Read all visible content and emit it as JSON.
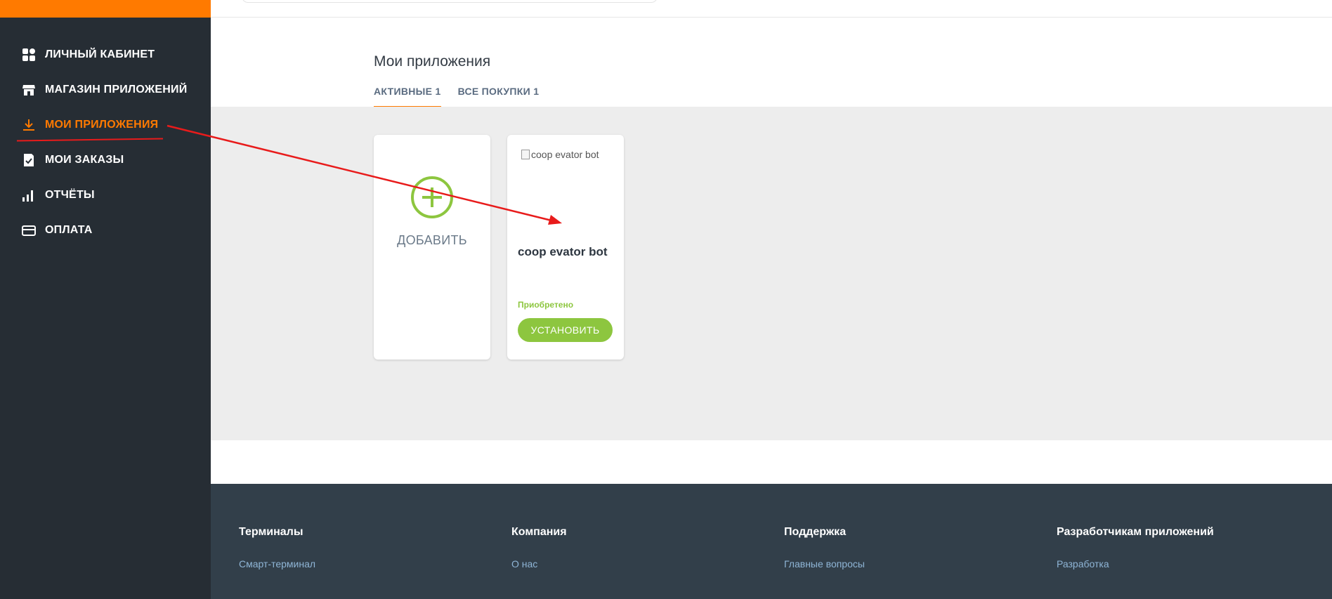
{
  "sidebar": {
    "items": [
      {
        "label": "ЛИЧНЫЙ КАБИНЕТ",
        "icon": "dashboard-icon"
      },
      {
        "label": "МАГАЗИН ПРИЛОЖЕНИЙ",
        "icon": "store-icon"
      },
      {
        "label": "МОИ ПРИЛОЖЕНИЯ",
        "icon": "download-icon",
        "active": true
      },
      {
        "label": "МОИ ЗАКАЗЫ",
        "icon": "orders-icon"
      },
      {
        "label": "ОТЧЁТЫ",
        "icon": "bar-chart-icon"
      },
      {
        "label": "ОПЛАТА",
        "icon": "credit-card-icon"
      }
    ]
  },
  "colors": {
    "accent": "#ff7a00",
    "sidebar_bg": "#262d34",
    "green": "#8dc63f",
    "annotation_red": "#e81b1b",
    "footer_bg": "#323f4a"
  },
  "main": {
    "title": "Мои приложения",
    "tabs": [
      {
        "label": "АКТИВНЫЕ 1",
        "active": true
      },
      {
        "label": "ВСЕ ПОКУПКИ 1",
        "active": false
      }
    ],
    "add_card": {
      "label": "ДОБАВИТЬ"
    },
    "app_card": {
      "image_alt": "coop evator bot",
      "name": "coop evator bot",
      "status": "Приобретено",
      "install_label": "УСТАНОВИТЬ"
    }
  },
  "footer": {
    "columns": [
      {
        "heading": "Терминалы",
        "links": [
          "Смарт-терминал"
        ]
      },
      {
        "heading": "Компания",
        "links": [
          "О нас"
        ]
      },
      {
        "heading": "Поддержка",
        "links": [
          "Главные вопросы"
        ]
      },
      {
        "heading": "Разработчикам приложений",
        "links": [
          "Разработка"
        ]
      }
    ]
  }
}
